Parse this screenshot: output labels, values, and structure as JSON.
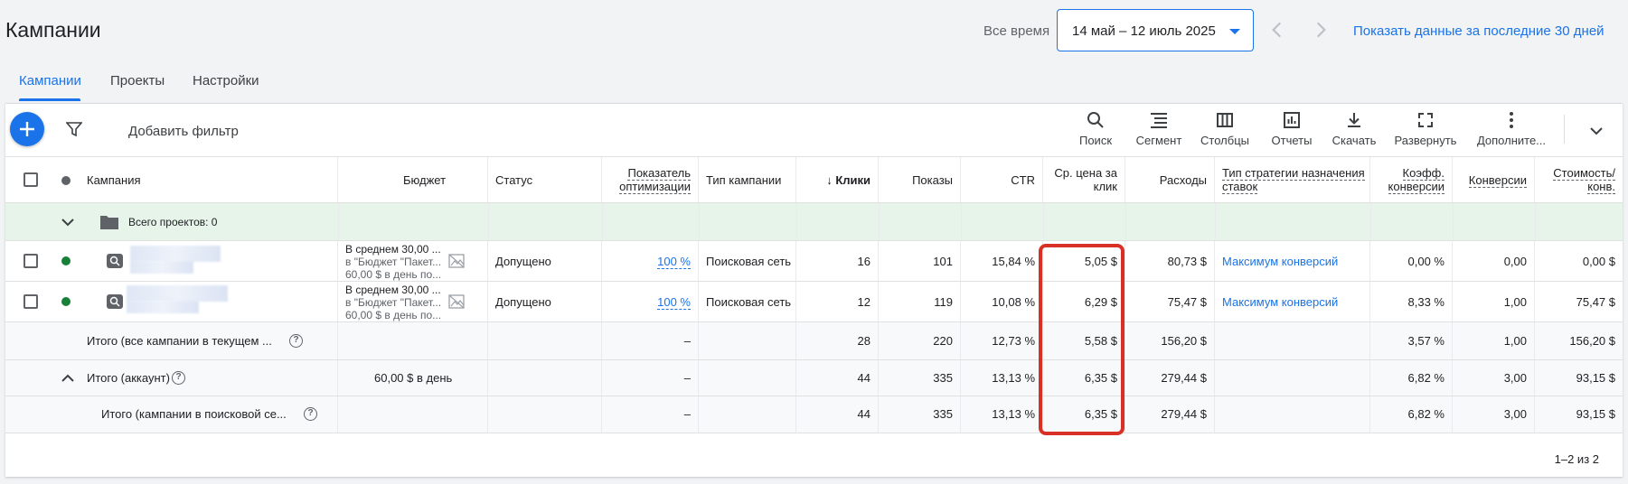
{
  "header": {
    "title": "Кампании",
    "date_range_label": "Все время",
    "date_range_value": "14 май – 12 июль 2025",
    "last30_link": "Показать данные за последние 30 дней"
  },
  "tabs": [
    {
      "label": "Кампании",
      "active": true
    },
    {
      "label": "Проекты",
      "active": false
    },
    {
      "label": "Настройки",
      "active": false
    }
  ],
  "toolbar": {
    "add_filter": "Добавить фильтр",
    "tools": [
      "Поиск",
      "Сегмент",
      "Столбцы",
      "Отчеты",
      "Скачать",
      "Развернуть",
      "Дополните..."
    ]
  },
  "columns": {
    "campaign": "Кампания",
    "budget": "Бюджет",
    "status": "Статус",
    "optimization_1": "Показатель",
    "optimization_2": "оптимизации",
    "campaign_type": "Тип кампании",
    "clicks": "Клики",
    "impressions": "Показы",
    "ctr": "CTR",
    "avg_cpc_1": "Ср. цена за",
    "avg_cpc_2": "клик",
    "cost": "Расходы",
    "bid_strategy_1": "Тип стратегии назначения",
    "bid_strategy_2": "ставок",
    "conv_rate_1": "Коэфф.",
    "conv_rate_2": "конверсии",
    "conversions": "Конверсии",
    "cost_per_conv_1": "Стоимость/",
    "cost_per_conv_2": "конв."
  },
  "projects_row": {
    "label": "Всего проектов: 0"
  },
  "rows": [
    {
      "budget_line1": "В среднем 30,00 ...",
      "budget_line2": "в \"Бюджет \"Пакет...",
      "budget_line3": "60,00 $ в день по...",
      "status": "Допущено",
      "optimization": "100 %",
      "campaign_type": "Поисковая сеть",
      "clicks": "16",
      "impressions": "101",
      "ctr": "15,84 %",
      "avg_cpc": "5,05 $",
      "cost": "80,73 $",
      "bid_strategy": "Максимум конверсий",
      "conv_rate": "0,00 %",
      "conversions": "0,00",
      "cost_per_conv": "0,00 $",
      "status_color": "#188038"
    },
    {
      "budget_line1": "В среднем 30,00 ...",
      "budget_line2": "в \"Бюджет \"Пакет...",
      "budget_line3": "60,00 $ в день по...",
      "status": "Допущено",
      "optimization": "100 %",
      "campaign_type": "Поисковая сеть",
      "clicks": "12",
      "impressions": "119",
      "ctr": "10,08 %",
      "avg_cpc": "6,29 $",
      "cost": "75,47 $",
      "bid_strategy": "Максимум конверсий",
      "conv_rate": "8,33 %",
      "conversions": "1,00",
      "cost_per_conv": "75,47 $",
      "status_color": "#188038"
    }
  ],
  "totals": [
    {
      "label": "Итого (все кампании в текущем ...",
      "budget": "",
      "optimization": "–",
      "clicks": "28",
      "impressions": "220",
      "ctr": "12,73 %",
      "avg_cpc": "5,58 $",
      "cost": "156,20 $",
      "conv_rate": "3,57 %",
      "conversions": "1,00",
      "cost_per_conv": "156,20 $"
    },
    {
      "label": "Итого (аккаунт)",
      "budget": "60,00 $ в день",
      "optimization": "–",
      "clicks": "44",
      "impressions": "335",
      "ctr": "13,13 %",
      "avg_cpc": "6,35 $",
      "cost": "279,44 $",
      "conv_rate": "6,82 %",
      "conversions": "3,00",
      "cost_per_conv": "93,15 $"
    },
    {
      "label": "Итого (кампании в поисковой се...",
      "budget": "",
      "optimization": "–",
      "clicks": "44",
      "impressions": "335",
      "ctr": "13,13 %",
      "avg_cpc": "6,35 $",
      "cost": "279,44 $",
      "conv_rate": "6,82 %",
      "conversions": "3,00",
      "cost_per_conv": "93,15 $"
    }
  ],
  "pagination": "1–2 из 2",
  "colors": {
    "accent": "#1a73e8",
    "enabled_dot": "#188038",
    "highlight": "#d93025",
    "project_row_bg": "#e6f4ea"
  }
}
